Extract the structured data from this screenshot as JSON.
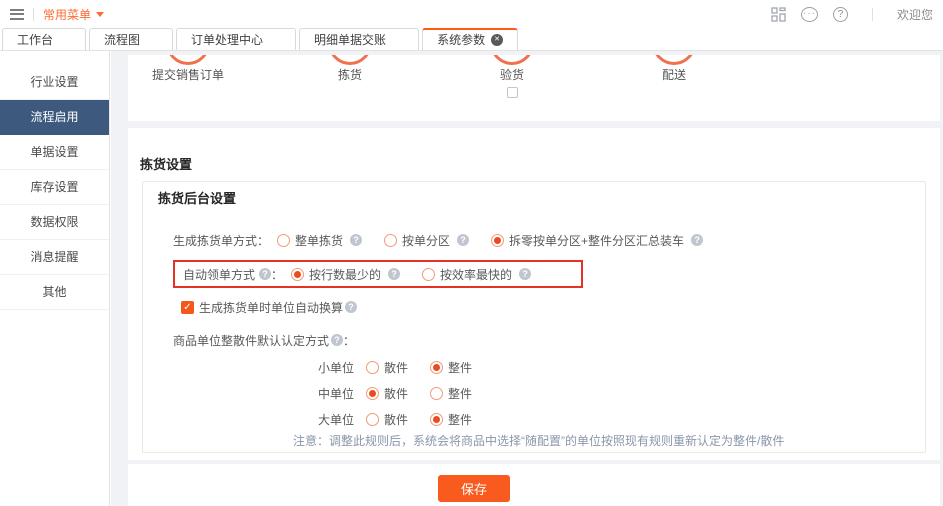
{
  "topbar": {
    "menu_label": "常用菜单",
    "welcome_text": "欢迎您"
  },
  "tabs": [
    {
      "label": "工作台",
      "active": false,
      "closable": false
    },
    {
      "label": "流程图",
      "active": false,
      "closable": false
    },
    {
      "label": "订单处理中心",
      "active": false,
      "closable": false
    },
    {
      "label": "明细单据交账",
      "active": false,
      "closable": false
    },
    {
      "label": "系统参数",
      "active": true,
      "closable": true
    }
  ],
  "sidebar": {
    "items": [
      {
        "label": "行业设置",
        "active": false
      },
      {
        "label": "流程启用",
        "active": true
      },
      {
        "label": "单据设置",
        "active": false
      },
      {
        "label": "库存设置",
        "active": false
      },
      {
        "label": "数据权限",
        "active": false
      },
      {
        "label": "消息提醒",
        "active": false
      },
      {
        "label": "其他",
        "active": false
      }
    ]
  },
  "workflow": {
    "steps": [
      {
        "label": "提交销售订单",
        "has_checkbox": false
      },
      {
        "label": "拣货",
        "has_checkbox": false
      },
      {
        "label": "验货",
        "has_checkbox": true
      },
      {
        "label": "配送",
        "has_checkbox": false
      }
    ]
  },
  "settings": {
    "section_title": "拣货设置",
    "subsection_title": "拣货后台设置",
    "generate_row": {
      "label": "生成拣货单方式：",
      "options": [
        {
          "label": "整单拣货",
          "selected": false
        },
        {
          "label": "按单分区",
          "selected": false
        },
        {
          "label": "拆零按单分区+整件分区汇总装车",
          "selected": true
        }
      ]
    },
    "auto_claim_row": {
      "label": "自动领单方式",
      "colon": "：",
      "options": [
        {
          "label": "按行数最少的",
          "selected": true
        },
        {
          "label": "按效率最快的",
          "selected": false
        }
      ]
    },
    "unit_convert_checkbox": {
      "label": "生成拣货单时单位自动换算",
      "checked": true
    },
    "unit_default_label": "商品单位整散件默认认定方式",
    "unit_default_colon": "：",
    "unit_rows": [
      {
        "label": "小单位",
        "options": [
          {
            "label": "散件",
            "selected": false
          },
          {
            "label": "整件",
            "selected": true
          }
        ]
      },
      {
        "label": "中单位",
        "options": [
          {
            "label": "散件",
            "selected": true
          },
          {
            "label": "整件",
            "selected": false
          }
        ]
      },
      {
        "label": "大单位",
        "options": [
          {
            "label": "散件",
            "selected": false
          },
          {
            "label": "整件",
            "selected": true
          }
        ]
      }
    ],
    "note": "注意：调整此规则后，系统会将商品中选择“随配置”的单位按照现有规则重新认定为整件/散件",
    "save_label": "保存"
  },
  "colors": {
    "accent_orange": "#f55a1c",
    "annotation_red": "#e43225",
    "sidebar_active_bg": "#3d5a7e",
    "note_text": "#8a96ab"
  }
}
